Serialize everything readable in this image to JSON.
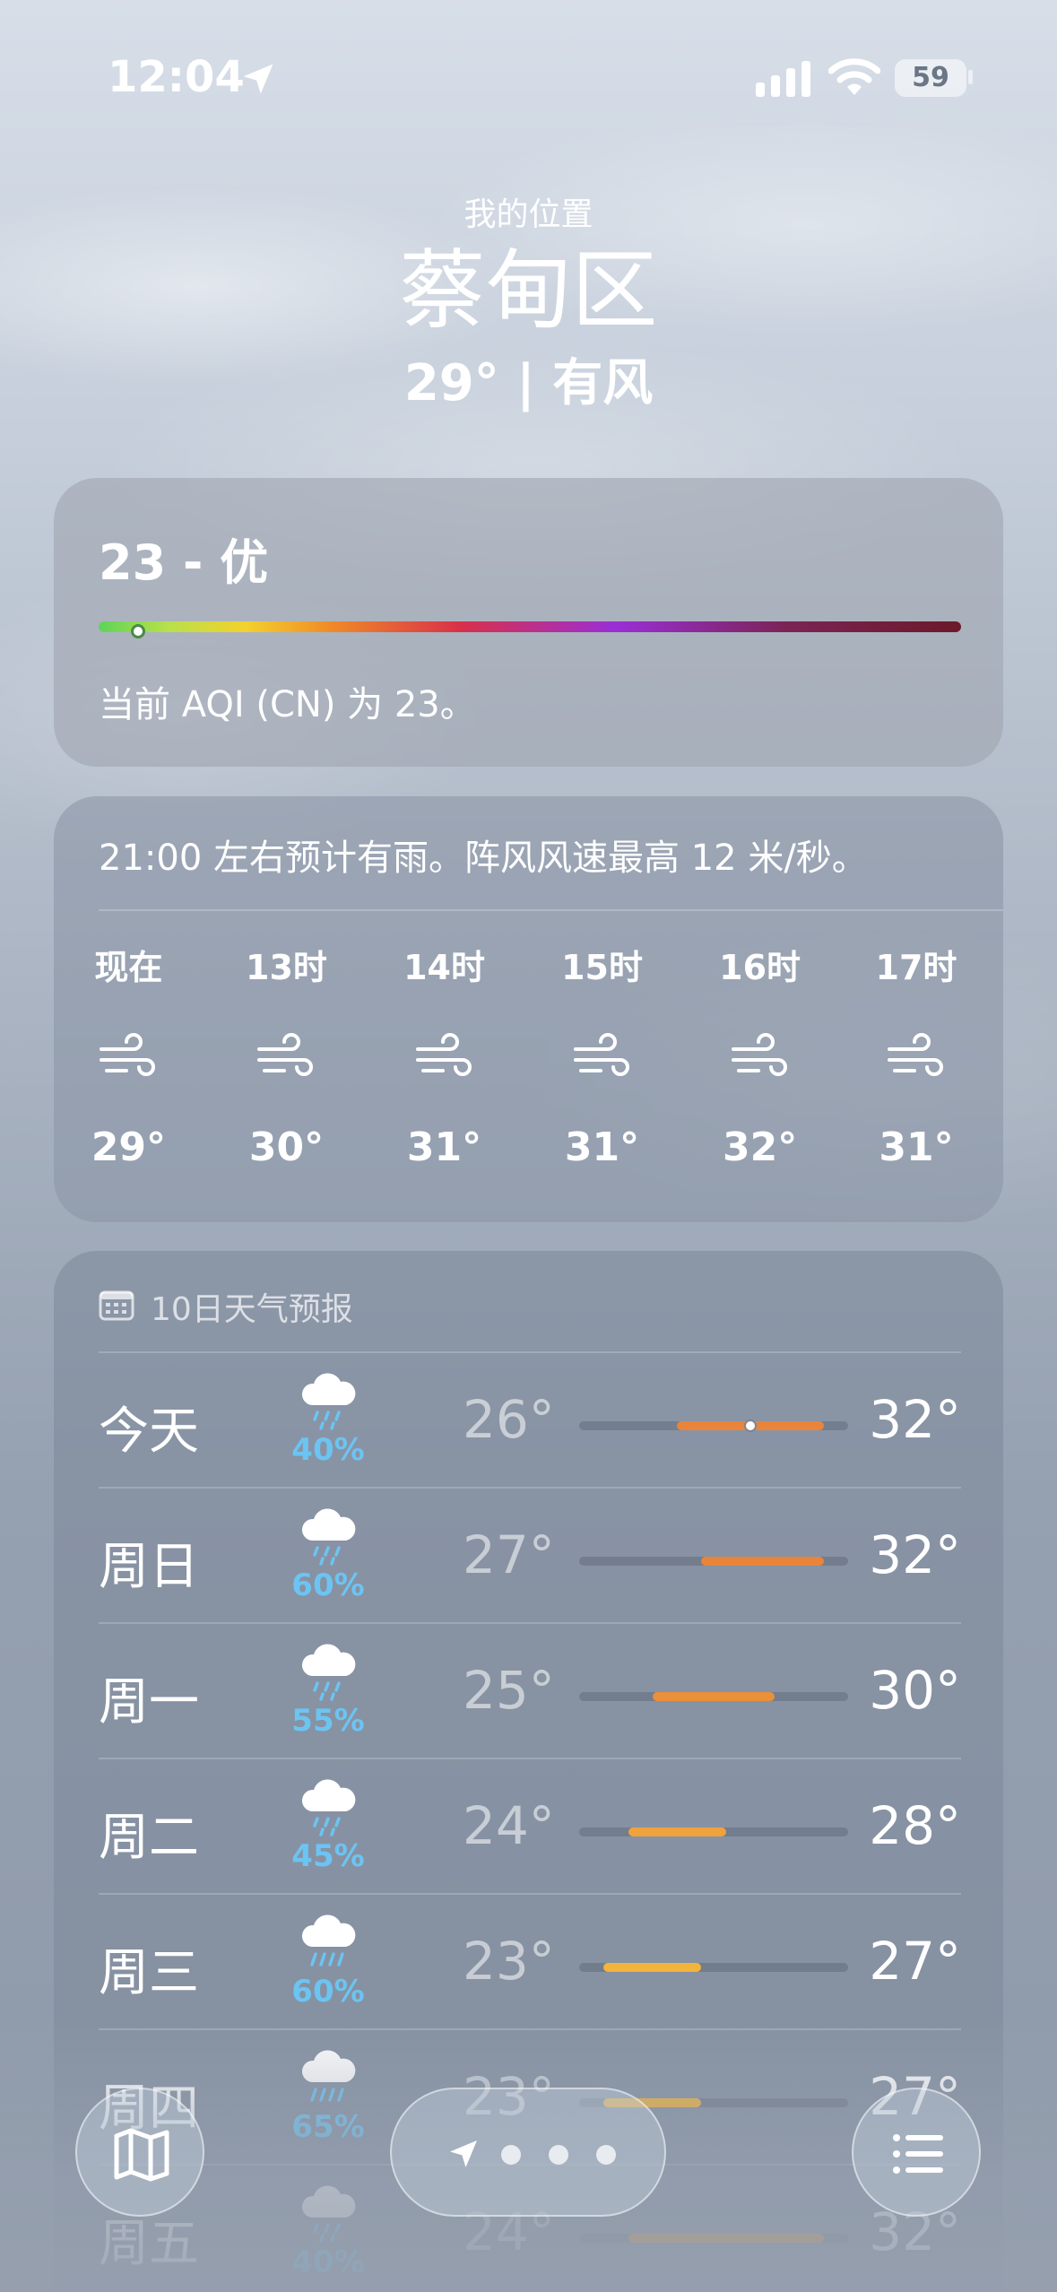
{
  "status_bar": {
    "time": "12:04",
    "battery": "59"
  },
  "header": {
    "my_location": "我的位置",
    "city": "蔡甸区",
    "summary": "29° | 有风"
  },
  "aqi": {
    "title": "23 - 优",
    "value": 23,
    "scale_max": 500,
    "description": "当前 AQI (CN) 为 23。"
  },
  "hourly": {
    "summary": "21:00 左右预计有雨。阵风风速最高 12 米/秒。",
    "hours": [
      {
        "label": "现在",
        "icon": "wind-icon",
        "temp": "29°"
      },
      {
        "label": "13时",
        "icon": "wind-icon",
        "temp": "30°"
      },
      {
        "label": "14时",
        "icon": "wind-icon",
        "temp": "31°"
      },
      {
        "label": "15时",
        "icon": "wind-icon",
        "temp": "31°"
      },
      {
        "label": "16时",
        "icon": "wind-icon",
        "temp": "32°"
      },
      {
        "label": "17时",
        "icon": "wind-icon",
        "temp": "31°"
      }
    ]
  },
  "daily": {
    "title": "10日天气预报",
    "range_min": 22,
    "range_max": 33,
    "days": [
      {
        "name": "今天",
        "icon": "rain-cloud-icon",
        "pop": "40%",
        "low": "26°",
        "high": "32°",
        "low_val": 26,
        "high_val": 32,
        "current_val": 29,
        "color": "#e8853a"
      },
      {
        "name": "周日",
        "icon": "rain-cloud-icon",
        "pop": "60%",
        "low": "27°",
        "high": "32°",
        "low_val": 27,
        "high_val": 32,
        "color": "#e8853a"
      },
      {
        "name": "周一",
        "icon": "rain-cloud-icon",
        "pop": "55%",
        "low": "25°",
        "high": "30°",
        "low_val": 25,
        "high_val": 30,
        "color": "#ea8f3a"
      },
      {
        "name": "周二",
        "icon": "rain-cloud-icon",
        "pop": "45%",
        "low": "24°",
        "high": "28°",
        "low_val": 24,
        "high_val": 28,
        "color": "#f0a23c"
      },
      {
        "name": "周三",
        "icon": "heavy-rain-cloud-icon",
        "pop": "60%",
        "low": "23°",
        "high": "27°",
        "low_val": 23,
        "high_val": 27,
        "color": "#f2b43a"
      },
      {
        "name": "周四",
        "icon": "heavy-rain-cloud-icon",
        "pop": "65%",
        "low": "23°",
        "high": "27°",
        "low_val": 23,
        "high_val": 27,
        "color": "#f2b43a"
      },
      {
        "name": "周五",
        "icon": "rain-cloud-icon",
        "pop": "40%",
        "low": "24°",
        "high": "32°",
        "low_val": 24,
        "high_val": 32,
        "color": "#e8953a"
      }
    ]
  },
  "toolbar": {
    "map_icon": "map-icon",
    "location_icon": "location-arrow-icon",
    "list_icon": "list-icon",
    "page_dots": 3
  }
}
